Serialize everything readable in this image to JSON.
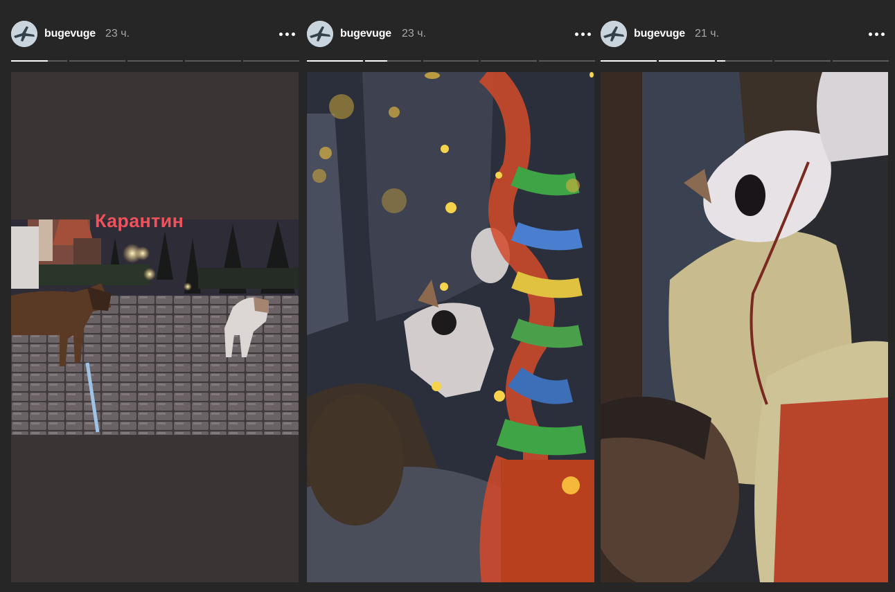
{
  "stories": [
    {
      "username": "bugevuge",
      "time": "23 ч.",
      "progress": {
        "segments": 5,
        "active_index": 0,
        "active_fraction": 0.65
      },
      "caption": "Карантин",
      "image": "Two dogs on a wet cobblestone street at night with street lamps and a leash in the foreground"
    },
    {
      "username": "bugevuge",
      "time": "23 ч.",
      "progress": {
        "segments": 5,
        "active_index": 1,
        "active_fraction": 0.4
      },
      "image": "Dark close-up of a person lying down with a dog and a multicolored rope toy, golden bokeh sparkles"
    },
    {
      "username": "bugevuge",
      "time": "21 ч.",
      "progress": {
        "segments": 5,
        "active_index": 2,
        "active_fraction": 0.15
      },
      "image": "Dark bed scene with a white dog lying on a pillow above a person's face"
    }
  ],
  "icons": {
    "more": "more-horizontal-icon",
    "avatar": "plane-avatar-icon"
  },
  "colors": {
    "background": "#262626",
    "caption": "#f0525c",
    "progress_track": "#5a5a5a",
    "progress_fill": "#ffffff"
  }
}
